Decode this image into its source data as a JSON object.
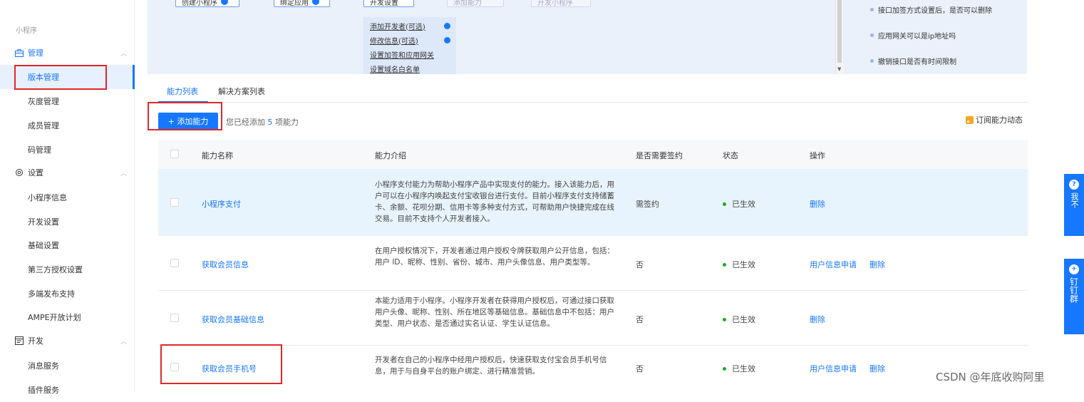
{
  "sidebar": {
    "section_label": "小程序",
    "groups": [
      {
        "label": "管理",
        "icon": "briefcase-icon"
      },
      {
        "label": "设置",
        "icon": "gear-icon"
      },
      {
        "label": "开发",
        "icon": "code-window-icon"
      }
    ],
    "items": [
      {
        "label": "版本管理"
      },
      {
        "label": "灰度管理"
      },
      {
        "label": "成员管理"
      },
      {
        "label": "码管理"
      },
      {
        "label": "小程序信息"
      },
      {
        "label": "开发设置"
      },
      {
        "label": "基础设置"
      },
      {
        "label": "第三方授权设置"
      },
      {
        "label": "多端发布支持"
      },
      {
        "label": "AMPE开放计划"
      },
      {
        "label": "消息服务"
      },
      {
        "label": "插件服务"
      }
    ]
  },
  "steps": [
    {
      "label": "创建小程序"
    },
    {
      "label": "绑定应用"
    },
    {
      "label": "开发设置"
    },
    {
      "label": "添加能力"
    },
    {
      "label": "开发小程序"
    }
  ],
  "dev_settings": [
    {
      "label": "添加开发者(可选)"
    },
    {
      "label": "修改信息(可选)"
    },
    {
      "label": "设置加签和应用网关"
    },
    {
      "label": "设置域名白名单"
    }
  ],
  "faq": [
    {
      "label": "接口加签方式设置后，是否可以删除"
    },
    {
      "label": "应用网关可以是ip地址吗"
    },
    {
      "label": "撤销接口是否有时间限制"
    }
  ],
  "tabs": [
    {
      "label": "能力列表"
    },
    {
      "label": "解决方案列表"
    }
  ],
  "toolbar": {
    "add_label": "+ 添加能力",
    "added_prefix": "您已经添加",
    "added_count": "5",
    "added_suffix": "项能力",
    "subscribe_label": "订阅能力动态"
  },
  "table": {
    "headers": [
      "能力名称",
      "能力介绍",
      "是否需要签约",
      "状态",
      "操作"
    ],
    "rows": [
      {
        "name": "小程序支付",
        "desc": "小程序支付能力为帮助小程序产品中实现支付的能力。接入该能力后，用户可以在小程序内唤起支付宝收银台进行支付。目前小程序支付支持储蓄卡、余额、花呗分期、信用卡等多种支付方式，可帮助用户快捷完成在线交易。目前不支持个人开发者接入。",
        "sign": "需签约",
        "status": "已生效",
        "ops": [
          "删除"
        ]
      },
      {
        "name": "获取会员信息",
        "desc": "在用户授权情况下，开发者通过用户授权令牌获取用户公开信息，包括：用户 ID、昵称、性别、省份、城市、用户头像信息、用户类型等。",
        "sign": "否",
        "status": "已生效",
        "ops": [
          "用户信息申请",
          "删除"
        ]
      },
      {
        "name": "获取会员基础信息",
        "desc": "本能力适用于小程序。小程序开发者在获得用户授权后，可通过接口获取用户头像、昵称、性别、所在地区等基础信息。基础信息中不包括：用户类型、用户状态、是否通过实名认证、学生认证信息。",
        "sign": "否",
        "status": "已生效",
        "ops": [
          "删除"
        ]
      },
      {
        "name": "获取会员手机号",
        "desc": "开发者在自己的小程序中经用户授权后，快速获取支付宝会员手机号信息，用于与自身平台的账户绑定、进行精准营销。",
        "sign": "否",
        "status": "已生效",
        "ops": [
          "用户信息申请",
          "删除"
        ]
      }
    ]
  },
  "float_tabs": [
    {
      "label": "我不",
      "icon": "question-icon"
    },
    {
      "label": "钉钉群",
      "icon": "dingtalk-icon"
    }
  ],
  "watermark": "CSDN @年底收购阿里",
  "colors": {
    "accent": "#1677ff",
    "highlight_row": "#e8f4fd",
    "annotation_red": "#e0272a"
  }
}
